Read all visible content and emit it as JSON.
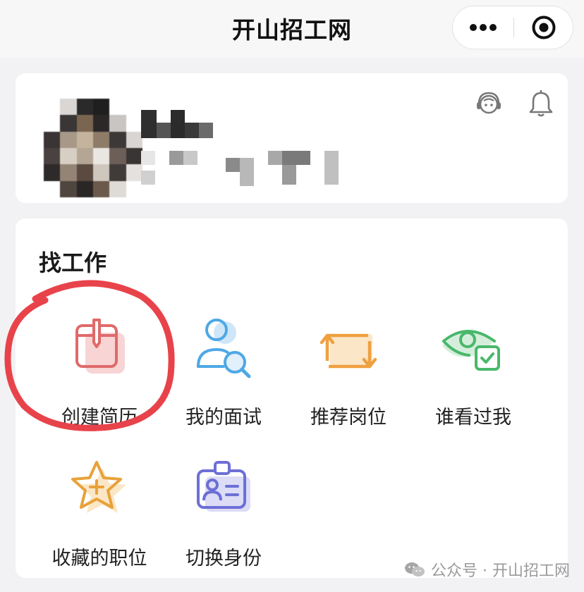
{
  "header": {
    "title": "开山招工网",
    "more_icon": "more-dots-icon",
    "close_icon": "target-close-icon"
  },
  "profile": {
    "avatar": "blurred-avatar",
    "name": "",
    "description": "",
    "service_icon": "customer-service-icon",
    "notification_icon": "bell-icon"
  },
  "jobs": {
    "title": "找工作",
    "items": [
      {
        "label": "创建简历",
        "icon": "resume-icon",
        "color": "#e06a6a"
      },
      {
        "label": "我的面试",
        "icon": "interview-search-icon",
        "color": "#4fa8e6"
      },
      {
        "label": "推荐岗位",
        "icon": "recommend-swap-icon",
        "color": "#f0a040"
      },
      {
        "label": "谁看过我",
        "icon": "eye-check-icon",
        "color": "#49b86a"
      },
      {
        "label": "收藏的职位",
        "icon": "star-plus-icon",
        "color": "#e8a23a"
      },
      {
        "label": "切换身份",
        "icon": "id-card-icon",
        "color": "#6d6fd6"
      }
    ]
  },
  "watermark": {
    "text": "公众号 · 开山招工网",
    "icon": "wechat-icon"
  },
  "annotation": {
    "color": "#e8434a"
  }
}
